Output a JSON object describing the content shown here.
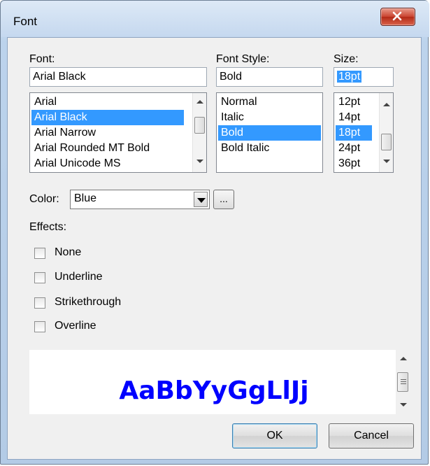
{
  "window": {
    "title": "Font",
    "close_glyph": "X"
  },
  "font": {
    "label": "Font:",
    "value": "Arial Black",
    "options": [
      "Arial",
      "Arial Black",
      "Arial Narrow",
      "Arial Rounded MT Bold",
      "Arial Unicode MS"
    ],
    "selected": "Arial Black"
  },
  "font_style": {
    "label": "Font Style:",
    "value": "Bold",
    "options": [
      "Normal",
      "Italic",
      "Bold",
      "Bold Italic"
    ],
    "selected": "Bold"
  },
  "size": {
    "label": "Size:",
    "value": "18pt",
    "options": [
      "12pt",
      "14pt",
      "18pt",
      "24pt",
      "36pt"
    ],
    "selected": "18pt"
  },
  "color": {
    "label": "Color:",
    "value": "Blue",
    "more_button": "..."
  },
  "effects": {
    "label": "Effects:",
    "items": [
      {
        "label": "None",
        "checked": false
      },
      {
        "label": "Underline",
        "checked": false
      },
      {
        "label": "Strikethrough",
        "checked": false
      },
      {
        "label": "Overline",
        "checked": false
      }
    ]
  },
  "preview": {
    "text": "AaBbYyGgLlJj",
    "color": "#0000ff"
  },
  "buttons": {
    "ok": "OK",
    "cancel": "Cancel"
  },
  "colors": {
    "selection": "#3399ff",
    "close_button": "#c9432f"
  }
}
